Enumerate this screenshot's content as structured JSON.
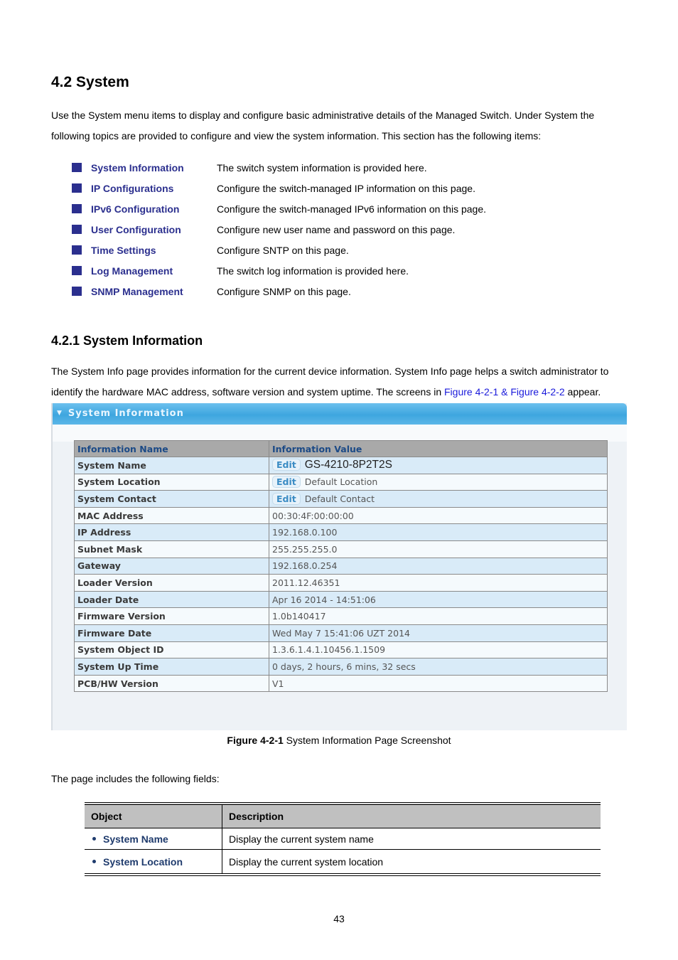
{
  "section": {
    "title": "4.2 System",
    "intro": "Use the System menu items to display and configure basic administrative details of the Managed Switch. Under System the following topics are provided to configure and view the system information. This section has the following items:",
    "topics": [
      {
        "name": "System Information",
        "desc": "The switch system information is provided here."
      },
      {
        "name": "IP Configurations",
        "desc": "Configure the switch-managed IP information on this page."
      },
      {
        "name": "IPv6 Configuration",
        "desc": "Configure the switch-managed IPv6 information on this page."
      },
      {
        "name": "User Configuration",
        "desc": "Configure new user name and password on this page."
      },
      {
        "name": "Time Settings",
        "desc": "Configure SNTP on this page."
      },
      {
        "name": "Log Management",
        "desc": "The switch log information is provided here."
      },
      {
        "name": "SNMP Management",
        "desc": "Configure SNMP on this page."
      }
    ]
  },
  "subsection": {
    "title": "4.2.1 System Information",
    "intro_before_link": "The System Info page provides information for the current device information. System Info page helps a switch administrator to identify the hardware MAC address, software version and system uptime. The screens in ",
    "intro_link": "Figure 4-2-1 & Figure 4-2-2",
    "intro_after_link": " appear."
  },
  "screenshot": {
    "panel_title": "System Information",
    "headers": [
      "Information Name",
      "Information Value"
    ],
    "edit_label": "Edit",
    "rows": [
      {
        "name": "System Name",
        "value": "GS-4210-8P2T2S",
        "editable": true
      },
      {
        "name": "System Location",
        "value": "Default Location",
        "editable": true
      },
      {
        "name": "System Contact",
        "value": "Default Contact",
        "editable": true
      },
      {
        "name": "MAC Address",
        "value": "00:30:4F:00:00:00",
        "editable": false
      },
      {
        "name": "IP Address",
        "value": "192.168.0.100",
        "editable": false
      },
      {
        "name": "Subnet Mask",
        "value": "255.255.255.0",
        "editable": false
      },
      {
        "name": "Gateway",
        "value": "192.168.0.254",
        "editable": false
      },
      {
        "name": "Loader Version",
        "value": "2011.12.46351",
        "editable": false
      },
      {
        "name": "Loader Date",
        "value": "Apr 16 2014 - 14:51:06",
        "editable": false
      },
      {
        "name": "Firmware Version",
        "value": "1.0b140417",
        "editable": false
      },
      {
        "name": "Firmware Date",
        "value": "Wed May 7 15:41:06 UZT 2014",
        "editable": false
      },
      {
        "name": "System Object ID",
        "value": "1.3.6.1.4.1.10456.1.1509",
        "editable": false
      },
      {
        "name": "System Up Time",
        "value": "0 days, 2 hours, 6 mins, 32 secs",
        "editable": false
      },
      {
        "name": "PCB/HW Version",
        "value": "V1",
        "editable": false
      }
    ]
  },
  "caption": {
    "bold": "Figure 4-2-1",
    "text": " System Information Page Screenshot"
  },
  "fields_intro": "The page includes the following fields:",
  "fields_table": {
    "headers": [
      "Object",
      "Description"
    ],
    "rows": [
      {
        "object": "System Name",
        "description": "Display the current system name"
      },
      {
        "object": "System Location",
        "description": "Display the current system location"
      }
    ]
  },
  "page_number": "43",
  "colors": {
    "topic_blue": "#2b2f8e",
    "link_blue": "#1a1adb",
    "panel_header": "#3ea6df"
  }
}
